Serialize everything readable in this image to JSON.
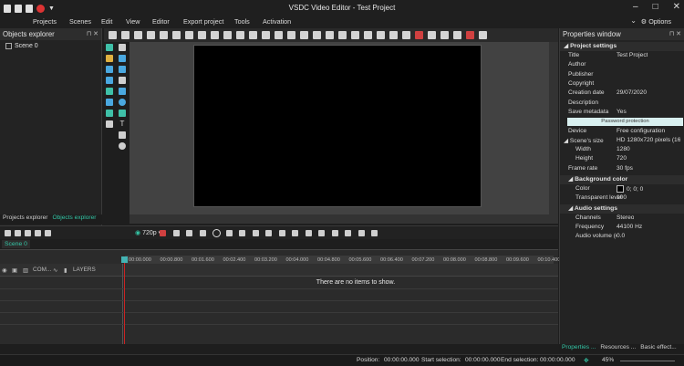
{
  "window": {
    "title": "VSDC Video Editor - Test Project",
    "min": "–",
    "max": "□",
    "close": "✕"
  },
  "menu": [
    "Projects",
    "Scenes",
    "Edit",
    "View",
    "Editor",
    "Export project",
    "Tools",
    "Activation"
  ],
  "options_label": "Options",
  "objects_explorer": {
    "title": "Objects explorer",
    "items": [
      "Scene 0"
    ]
  },
  "left_tabs": [
    "Projects explorer",
    "Objects explorer"
  ],
  "playback": {
    "resolution": "720p"
  },
  "timeline": {
    "scene_tab": "Scene 0",
    "header_labels": [
      "COM...",
      "LAYERS"
    ],
    "ruler_ticks": [
      "00:00.000",
      "00:00.800",
      "00:01.600",
      "00:02.400",
      "00:03.200",
      "00:04.000",
      "00:04.800",
      "00:05.600",
      "00:06.400",
      "00:07.200",
      "00:08.000",
      "00:08.800",
      "00:09.600",
      "00:10.400"
    ],
    "empty_message": "There are no items to show."
  },
  "properties": {
    "title": "Properties window",
    "project_settings_label": "Project settings",
    "rows": [
      {
        "k": "Title",
        "v": "Test Project"
      },
      {
        "k": "Author",
        "v": ""
      },
      {
        "k": "Publisher",
        "v": ""
      },
      {
        "k": "Copyright",
        "v": ""
      },
      {
        "k": "Creation date",
        "v": "29/07/2020"
      },
      {
        "k": "Description",
        "v": ""
      },
      {
        "k": "Save metadata",
        "v": "Yes"
      }
    ],
    "password_button": "Password protection",
    "device": {
      "k": "Device",
      "v": "Free configuration"
    },
    "scene_size": {
      "k": "Scene's size",
      "v": "HD 1280x720 pixels (16"
    },
    "width": {
      "k": "Width",
      "v": "1280"
    },
    "height": {
      "k": "Height",
      "v": "720"
    },
    "frame_rate": {
      "k": "Frame rate",
      "v": "30 fps"
    },
    "background_color_label": "Background color",
    "color": {
      "k": "Color",
      "v": "0; 0; 0"
    },
    "transparent": {
      "k": "Transparent level",
      "v": "100"
    },
    "audio_settings_label": "Audio settings",
    "channels": {
      "k": "Channels",
      "v": "Stereo"
    },
    "frequency": {
      "k": "Frequency",
      "v": "44100 Hz"
    },
    "audio_volume": {
      "k": "Audio volume (dE",
      "v": "0.0"
    }
  },
  "right_tabs": [
    "Properties ...",
    "Resources ...",
    "Basic effect..."
  ],
  "status": {
    "position_label": "Position:",
    "position": "00:00:00.000",
    "start_label": "Start selection:",
    "start": "00:00:00.000",
    "end_label": "End selection:",
    "end": "00:00:00.000",
    "zoom": "45%"
  },
  "colors": {
    "accent": "#34c6a6",
    "playhead": "#cc2222"
  }
}
